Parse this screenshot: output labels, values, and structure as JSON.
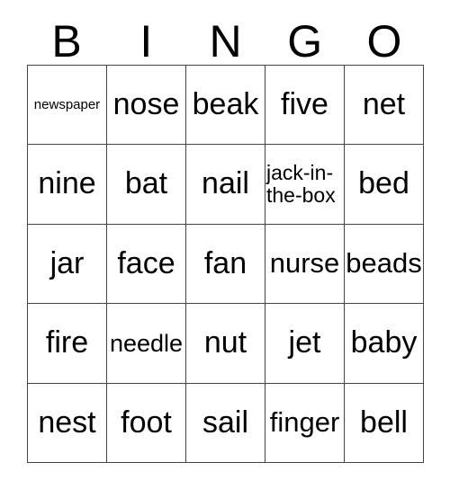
{
  "card": {
    "title": "BINGO",
    "headers": [
      "B",
      "I",
      "N",
      "G",
      "O"
    ],
    "colors": {
      "background": "#ffffff",
      "text": "#000000",
      "border": "#444444"
    },
    "grid": {
      "rows": 5,
      "columns": 5
    },
    "cells": [
      [
        {
          "label": "newspaper",
          "fit": "size-xs"
        },
        {
          "label": "nose",
          "fit": ""
        },
        {
          "label": "beak",
          "fit": ""
        },
        {
          "label": "five",
          "fit": ""
        },
        {
          "label": "net",
          "fit": ""
        }
      ],
      [
        {
          "label": "nine",
          "fit": ""
        },
        {
          "label": "bat",
          "fit": ""
        },
        {
          "label": "nail",
          "fit": ""
        },
        {
          "label": "jack-in-the-box",
          "fit": "wrap"
        },
        {
          "label": "bed",
          "fit": ""
        }
      ],
      [
        {
          "label": "jar",
          "fit": ""
        },
        {
          "label": "face",
          "fit": ""
        },
        {
          "label": "fan",
          "fit": ""
        },
        {
          "label": "nurse",
          "fit": "size-lg"
        },
        {
          "label": "beads",
          "fit": "size-lg"
        }
      ],
      [
        {
          "label": "fire",
          "fit": ""
        },
        {
          "label": "needle",
          "fit": "size-md"
        },
        {
          "label": "nut",
          "fit": ""
        },
        {
          "label": "jet",
          "fit": ""
        },
        {
          "label": "baby",
          "fit": ""
        }
      ],
      [
        {
          "label": "nest",
          "fit": ""
        },
        {
          "label": "foot",
          "fit": ""
        },
        {
          "label": "sail",
          "fit": ""
        },
        {
          "label": "finger",
          "fit": "size-lg"
        },
        {
          "label": "bell",
          "fit": ""
        }
      ]
    ]
  }
}
